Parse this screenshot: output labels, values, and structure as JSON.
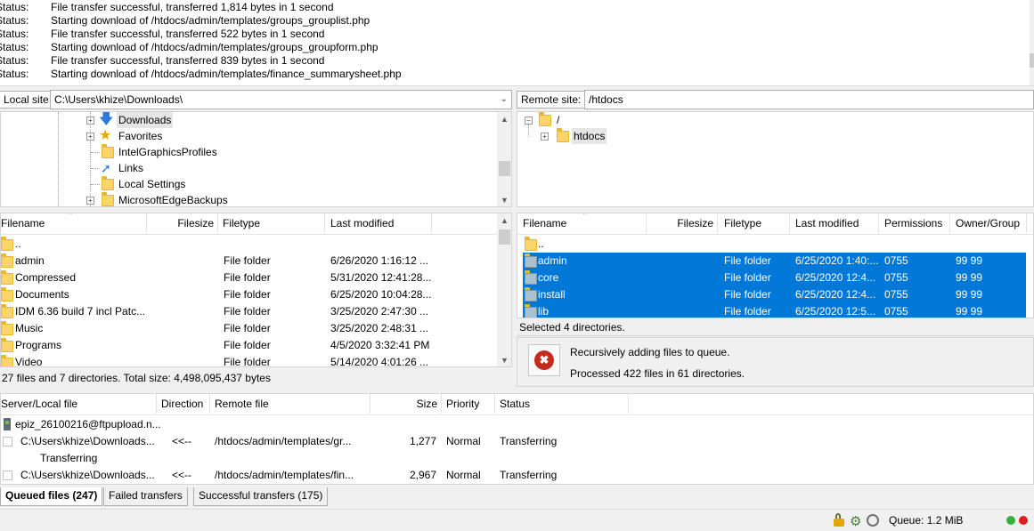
{
  "log": {
    "entries": [
      {
        "label": "Status:",
        "message": "File transfer successful, transferred 1,814 bytes in 1 second"
      },
      {
        "label": "Status:",
        "message": "Starting download of /htdocs/admin/templates/groups_grouplist.php"
      },
      {
        "label": "Status:",
        "message": "File transfer successful, transferred 522 bytes in 1 second"
      },
      {
        "label": "Status:",
        "message": "Starting download of /htdocs/admin/templates/groups_groupform.php"
      },
      {
        "label": "Status:",
        "message": "File transfer successful, transferred 839 bytes in 1 second"
      },
      {
        "label": "Status:",
        "message": "Starting download of /htdocs/admin/templates/finance_summarysheet.php"
      }
    ]
  },
  "local": {
    "site_label": "Local site:",
    "path": "C:\\Users\\khize\\Downloads\\",
    "tree": [
      "Downloads",
      "Favorites",
      "IntelGraphicsProfiles",
      "Links",
      "Local Settings",
      "MicrosoftEdgeBackups"
    ],
    "columns": {
      "filename": "Filename",
      "filesize": "Filesize",
      "filetype": "Filetype",
      "modified": "Last modified"
    },
    "rows": [
      {
        "name": "..",
        "type": "",
        "modified": ""
      },
      {
        "name": "admin",
        "type": "File folder",
        "modified": "6/26/2020 1:16:12 ..."
      },
      {
        "name": "Compressed",
        "type": "File folder",
        "modified": "5/31/2020 12:41:28..."
      },
      {
        "name": "Documents",
        "type": "File folder",
        "modified": "6/25/2020 10:04:28..."
      },
      {
        "name": "IDM 6.36 build 7 incl Patc...",
        "type": "File folder",
        "modified": "3/25/2020 2:47:30 ..."
      },
      {
        "name": "Music",
        "type": "File folder",
        "modified": "3/25/2020 2:48:31 ..."
      },
      {
        "name": "Programs",
        "type": "File folder",
        "modified": "4/5/2020 3:32:41 PM"
      },
      {
        "name": "Video",
        "type": "File folder",
        "modified": "5/14/2020 4:01:26 ..."
      }
    ],
    "status": "27 files and 7 directories. Total size: 4,498,095,437 bytes"
  },
  "remote": {
    "site_label": "Remote site:",
    "path": "/htdocs",
    "tree": [
      "/",
      "htdocs"
    ],
    "columns": {
      "filename": "Filename",
      "filesize": "Filesize",
      "filetype": "Filetype",
      "modified": "Last modified",
      "permissions": "Permissions",
      "owner": "Owner/Group"
    },
    "rows": [
      {
        "name": "..",
        "type": "",
        "modified": "",
        "perm": "",
        "owner": ""
      },
      {
        "name": "admin",
        "type": "File folder",
        "modified": "6/25/2020 1:40:...",
        "perm": "0755",
        "owner": "99 99"
      },
      {
        "name": "core",
        "type": "File folder",
        "modified": "6/25/2020 12:4...",
        "perm": "0755",
        "owner": "99 99"
      },
      {
        "name": "install",
        "type": "File folder",
        "modified": "6/25/2020 12:4...",
        "perm": "0755",
        "owner": "99 99"
      },
      {
        "name": "lib",
        "type": "File folder",
        "modified": "6/25/2020 12:5...",
        "perm": "0755",
        "owner": "99 99"
      }
    ],
    "status": "Selected 4 directories.",
    "notice": {
      "line1": "Recursively adding files to queue.",
      "line2": "Processed 422 files in 61 directories."
    }
  },
  "queue": {
    "columns": {
      "server": "Server/Local file",
      "direction": "Direction",
      "remote": "Remote file",
      "size": "Size",
      "priority": "Priority",
      "status": "Status"
    },
    "server": "epiz_26100216@ftpupload.n...",
    "items": [
      {
        "local": "C:\\Users\\khize\\Downloads...",
        "direction": "<<--",
        "remote": "/htdocs/admin/templates/gr...",
        "size": "1,277",
        "priority": "Normal",
        "status": "Transferring",
        "sub": "Transferring"
      },
      {
        "local": "C:\\Users\\khize\\Downloads...",
        "direction": "<<--",
        "remote": "/htdocs/admin/templates/fin...",
        "size": "2,967",
        "priority": "Normal",
        "status": "Transferring"
      }
    ],
    "tabs": [
      "Queued files (247)",
      "Failed transfers",
      "Successful transfers (175)"
    ]
  },
  "statusbar": {
    "queue": "Queue: 1.2 MiB"
  },
  "colors": {
    "selection": "#0078d7",
    "folder": "#fcd56a",
    "error": "#c42b1c"
  }
}
